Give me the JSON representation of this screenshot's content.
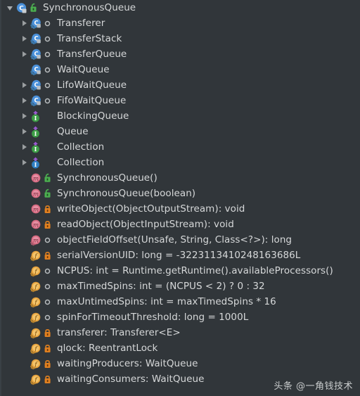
{
  "panel": {
    "name": "structure-tool-window",
    "background": "#31363a",
    "text_color": "#d6d8d9"
  },
  "rows": [
    {
      "label": "SynchronousQueue",
      "kind": "class",
      "visibility": "public",
      "depth": 0,
      "expanded": true,
      "has_twisty": true
    },
    {
      "label": "Transferer",
      "kind": "class-abstract",
      "visibility": "package",
      "depth": 1,
      "expanded": false,
      "has_twisty": true
    },
    {
      "label": "TransferStack",
      "kind": "class-inner",
      "visibility": "package",
      "depth": 1,
      "expanded": false,
      "has_twisty": true
    },
    {
      "label": "TransferQueue",
      "kind": "class-inner",
      "visibility": "package",
      "depth": 1,
      "expanded": false,
      "has_twisty": true
    },
    {
      "label": "WaitQueue",
      "kind": "class-inner",
      "visibility": "package",
      "depth": 1,
      "expanded": false,
      "has_twisty": false
    },
    {
      "label": "LifoWaitQueue",
      "kind": "class-inner",
      "visibility": "package",
      "depth": 1,
      "expanded": false,
      "has_twisty": true
    },
    {
      "label": "FifoWaitQueue",
      "kind": "class-inner",
      "visibility": "package",
      "depth": 1,
      "expanded": false,
      "has_twisty": true
    },
    {
      "label": "BlockingQueue",
      "kind": "interface-inherited",
      "visibility": "none",
      "depth": 1,
      "expanded": false,
      "has_twisty": true
    },
    {
      "label": "Queue",
      "kind": "interface-inherited",
      "visibility": "none",
      "depth": 1,
      "expanded": false,
      "has_twisty": true
    },
    {
      "label": "Collection",
      "kind": "interface-inherited",
      "visibility": "none",
      "depth": 1,
      "expanded": false,
      "has_twisty": true
    },
    {
      "label": "Collection",
      "kind": "interface-inherited-alt",
      "visibility": "none",
      "depth": 1,
      "expanded": false,
      "has_twisty": true
    },
    {
      "label": "SynchronousQueue()",
      "kind": "method",
      "visibility": "public",
      "depth": 1,
      "expanded": false,
      "has_twisty": false
    },
    {
      "label": "SynchronousQueue(boolean)",
      "kind": "method",
      "visibility": "public",
      "depth": 1,
      "expanded": false,
      "has_twisty": false
    },
    {
      "label": "writeObject(ObjectOutputStream): void",
      "kind": "method",
      "visibility": "private",
      "depth": 1,
      "expanded": false,
      "has_twisty": false
    },
    {
      "label": "readObject(ObjectInputStream): void",
      "kind": "method",
      "visibility": "private",
      "depth": 1,
      "expanded": false,
      "has_twisty": false
    },
    {
      "label": "objectFieldOffset(Unsafe, String, Class<?>): long",
      "kind": "method-static",
      "visibility": "package",
      "depth": 1,
      "expanded": false,
      "has_twisty": false
    },
    {
      "label": "serialVersionUID: long = -3223113410248163686L",
      "kind": "field",
      "visibility": "private",
      "depth": 1,
      "expanded": false,
      "has_twisty": false
    },
    {
      "label": "NCPUS: int = Runtime.getRuntime().availableProcessors()",
      "kind": "field",
      "visibility": "package",
      "depth": 1,
      "expanded": false,
      "has_twisty": false
    },
    {
      "label": "maxTimedSpins: int = (NCPUS < 2) ? 0 : 32",
      "kind": "field",
      "visibility": "package",
      "depth": 1,
      "expanded": false,
      "has_twisty": false
    },
    {
      "label": "maxUntimedSpins: int = maxTimedSpins * 16",
      "kind": "field",
      "visibility": "package",
      "depth": 1,
      "expanded": false,
      "has_twisty": false
    },
    {
      "label": "spinForTimeoutThreshold: long = 1000L",
      "kind": "field",
      "visibility": "package",
      "depth": 1,
      "expanded": false,
      "has_twisty": false
    },
    {
      "label": "transferer: Transferer<E>",
      "kind": "field",
      "visibility": "private",
      "depth": 1,
      "expanded": false,
      "has_twisty": false
    },
    {
      "label": "qlock: ReentrantLock",
      "kind": "field",
      "visibility": "private",
      "depth": 1,
      "expanded": false,
      "has_twisty": false
    },
    {
      "label": "waitingProducers: WaitQueue",
      "kind": "field",
      "visibility": "private",
      "depth": 1,
      "expanded": false,
      "has_twisty": false
    },
    {
      "label": "waitingConsumers: WaitQueue",
      "kind": "field",
      "visibility": "private",
      "depth": 1,
      "expanded": false,
      "has_twisty": false
    }
  ],
  "icons": {
    "expand_collapsed": "chevron-right-icon",
    "expand_expanded": "chevron-down-icon",
    "class": "class-icon",
    "class_inner": "inner-class-icon",
    "class_abstract": "abstract-class-icon",
    "interface": "interface-icon",
    "method": "method-icon",
    "method_static": "static-method-icon",
    "field": "field-icon",
    "public": "lock-open-icon",
    "private": "lock-closed-icon",
    "package": "package-private-icon",
    "inherited": "inherited-arrow-icon"
  },
  "colors": {
    "class_blue": "#4a90d9",
    "interface_green": "#3d9e46",
    "method_pink": "#d96b82",
    "field_orange": "#e8a33d",
    "lock_open_green": "#4caf50",
    "lock_closed_orange": "#e08020",
    "inherit_purple": "#9b59d0"
  },
  "watermark": {
    "text": "头条 @一角钱技术"
  }
}
